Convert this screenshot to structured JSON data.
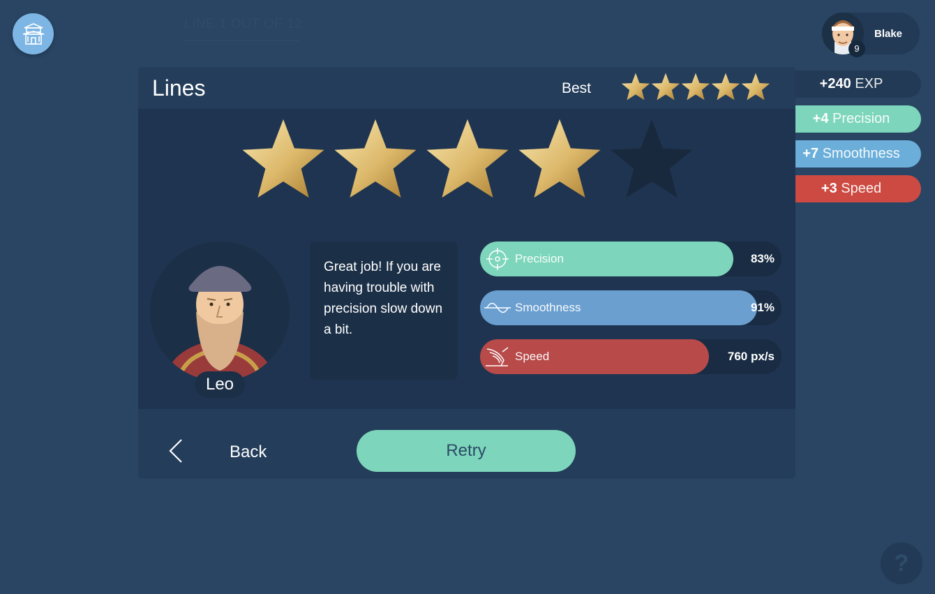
{
  "header": {
    "line_counter": "LINE 1 OUT OF 12",
    "home_icon": "dojo-building-icon"
  },
  "user": {
    "name": "Blake",
    "level": "9"
  },
  "rewards": {
    "exp": {
      "amount": "+240",
      "name": "EXP"
    },
    "precision": {
      "amount": "+4",
      "name": "Precision",
      "color": "#7dd6bb"
    },
    "smoothness": {
      "amount": "+7",
      "name": "Smoothness",
      "color": "#6aaed9"
    },
    "speed": {
      "amount": "+3",
      "name": "Speed",
      "color": "#cc4a42"
    }
  },
  "panel": {
    "title": "Lines",
    "best_label": "Best",
    "best_stars": 5,
    "earned_stars": 4,
    "max_stars": 5
  },
  "mentor": {
    "name": "Leo",
    "message": "Great job! If you are having trouble with precision slow down a bit."
  },
  "stats": [
    {
      "label": "Precision",
      "value": "83%",
      "fill_fraction": 0.84,
      "color": "#7dd6bb",
      "icon": "crosshair-icon"
    },
    {
      "label": "Smoothness",
      "value": "91%",
      "fill_fraction": 0.92,
      "color": "#6a9fd0",
      "icon": "sine-wave-icon"
    },
    {
      "label": "Speed",
      "value": "760 px/s",
      "fill_fraction": 0.76,
      "color": "#b84a4a",
      "icon": "winged-speed-icon"
    }
  ],
  "actions": {
    "back_label": "Back",
    "retry_label": "Retry"
  },
  "help": {
    "label": "?"
  }
}
